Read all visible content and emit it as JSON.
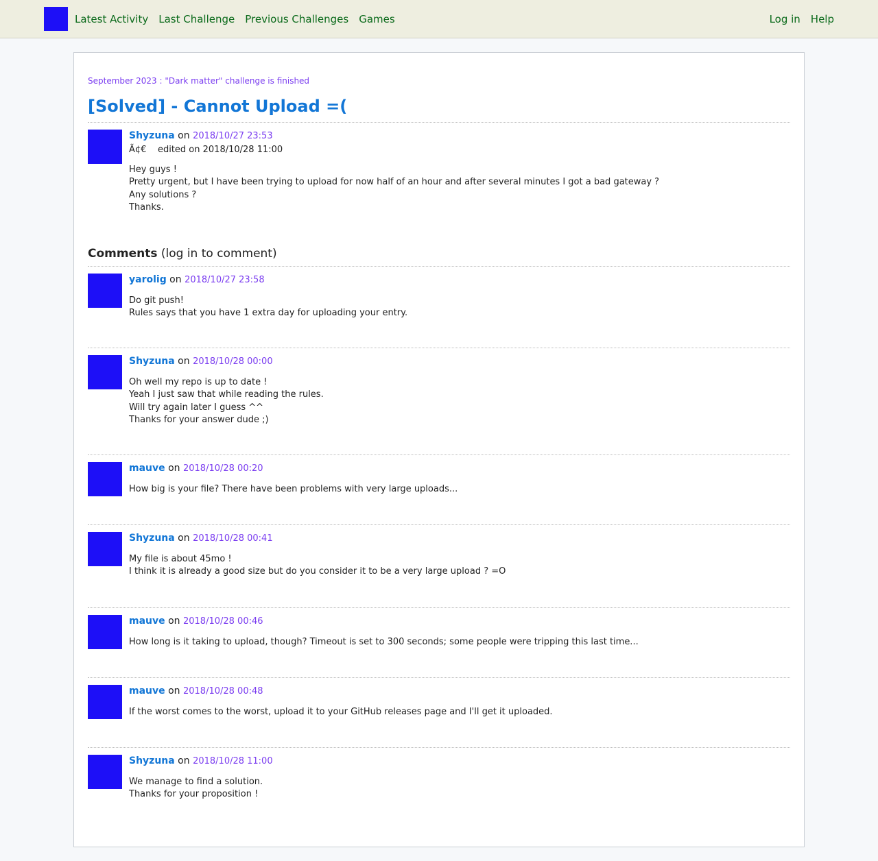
{
  "nav": {
    "left": [
      "Latest Activity",
      "Last Challenge",
      "Previous Challenges",
      "Games"
    ],
    "right": [
      "Log in",
      "Help"
    ]
  },
  "announcement": "September 2023 : \"Dark matter\" challenge is finished",
  "thread": {
    "title": "[Solved] - Cannot Upload =(",
    "author": "Shyzuna",
    "on": "on",
    "date": "2018/10/27 23:53",
    "edited_prefix": "Ã¢€",
    "edited": "edited on 2018/10/28 11:00",
    "body": "Hey guys !\nPretty urgent, but I have been trying to upload for now half of an hour and after several minutes I got a bad gateway ?\nAny solutions ?\nThanks."
  },
  "comments_header": {
    "title": "Comments",
    "login_hint": "(log in to comment)"
  },
  "comments": [
    {
      "author": "yarolig",
      "on": "on",
      "date": "2018/10/27 23:58",
      "body": "Do git push!\nRules says that you have 1 extra day for uploading your entry."
    },
    {
      "author": "Shyzuna",
      "on": "on",
      "date": "2018/10/28 00:00",
      "body": "Oh well my repo is up to date !\nYeah I just saw that while reading the rules.\nWill try again later I guess ^^\nThanks for your answer dude ;)"
    },
    {
      "author": "mauve",
      "on": "on",
      "date": "2018/10/28 00:20",
      "body": "How big is your file? There have been problems with very large uploads..."
    },
    {
      "author": "Shyzuna",
      "on": "on",
      "date": "2018/10/28 00:41",
      "body": "My file is about 45mo !\nI think it is already a good size but do you consider it to be a very large upload ? =O"
    },
    {
      "author": "mauve",
      "on": "on",
      "date": "2018/10/28 00:46",
      "body": "How long is it taking to upload, though? Timeout is set to 300 seconds; some people were tripping this last time..."
    },
    {
      "author": "mauve",
      "on": "on",
      "date": "2018/10/28 00:48",
      "body": "If the worst comes to the worst, upload it to your GitHub releases page and I'll get it uploaded."
    },
    {
      "author": "Shyzuna",
      "on": "on",
      "date": "2018/10/28 11:00",
      "body": "We manage to find a solution.\nThanks for your proposition !"
    }
  ]
}
